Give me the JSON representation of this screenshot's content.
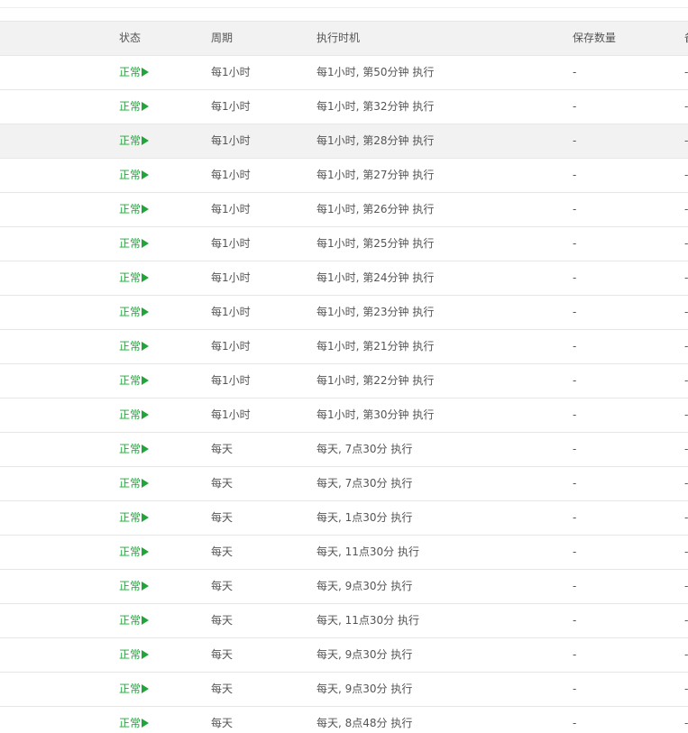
{
  "table": {
    "headers": {
      "status": "状态",
      "cycle": "周期",
      "exec_time": "执行时机",
      "keep_count": "保存数量",
      "op_partial": "备"
    },
    "rows": [
      {
        "status": "正常",
        "cycle": "每1小时",
        "exec_time": "每1小时, 第50分钟 执行",
        "keep_count": "-",
        "op": "-"
      },
      {
        "status": "正常",
        "cycle": "每1小时",
        "exec_time": "每1小时, 第32分钟 执行",
        "keep_count": "-",
        "op": "-"
      },
      {
        "status": "正常",
        "cycle": "每1小时",
        "exec_time": "每1小时, 第28分钟 执行",
        "keep_count": "-",
        "op": "-"
      },
      {
        "status": "正常",
        "cycle": "每1小时",
        "exec_time": "每1小时, 第27分钟 执行",
        "keep_count": "-",
        "op": "-"
      },
      {
        "status": "正常",
        "cycle": "每1小时",
        "exec_time": "每1小时, 第26分钟 执行",
        "keep_count": "-",
        "op": "-"
      },
      {
        "status": "正常",
        "cycle": "每1小时",
        "exec_time": "每1小时, 第25分钟 执行",
        "keep_count": "-",
        "op": "-"
      },
      {
        "status": "正常",
        "cycle": "每1小时",
        "exec_time": "每1小时, 第24分钟 执行",
        "keep_count": "-",
        "op": "-"
      },
      {
        "status": "正常",
        "cycle": "每1小时",
        "exec_time": "每1小时, 第23分钟 执行",
        "keep_count": "-",
        "op": "-"
      },
      {
        "status": "正常",
        "cycle": "每1小时",
        "exec_time": "每1小时, 第21分钟 执行",
        "keep_count": "-",
        "op": "-"
      },
      {
        "status": "正常",
        "cycle": "每1小时",
        "exec_time": "每1小时, 第22分钟 执行",
        "keep_count": "-",
        "op": "-"
      },
      {
        "status": "正常",
        "cycle": "每1小时",
        "exec_time": "每1小时, 第30分钟 执行",
        "keep_count": "-",
        "op": "-"
      },
      {
        "status": "正常",
        "cycle": "每天",
        "exec_time": "每天, 7点30分 执行",
        "keep_count": "-",
        "op": "-"
      },
      {
        "status": "正常",
        "cycle": "每天",
        "exec_time": "每天, 7点30分 执行",
        "keep_count": "-",
        "op": "-"
      },
      {
        "status": "正常",
        "cycle": "每天",
        "exec_time": "每天, 1点30分 执行",
        "keep_count": "-",
        "op": "-"
      },
      {
        "status": "正常",
        "cycle": "每天",
        "exec_time": "每天, 11点30分 执行",
        "keep_count": "-",
        "op": "-"
      },
      {
        "status": "正常",
        "cycle": "每天",
        "exec_time": "每天, 9点30分 执行",
        "keep_count": "-",
        "op": "-"
      },
      {
        "status": "正常",
        "cycle": "每天",
        "exec_time": "每天, 11点30分 执行",
        "keep_count": "-",
        "op": "-"
      },
      {
        "status": "正常",
        "cycle": "每天",
        "exec_time": "每天, 9点30分 执行",
        "keep_count": "-",
        "op": "-"
      },
      {
        "status": "正常",
        "cycle": "每天",
        "exec_time": "每天, 9点30分 执行",
        "keep_count": "-",
        "op": "-"
      },
      {
        "status": "正常",
        "cycle": "每天",
        "exec_time": "每天, 8点48分 执行",
        "keep_count": "-",
        "op": "-"
      }
    ]
  },
  "colors": {
    "status_ok": "#20a53a",
    "header_bg": "#f2f2f2",
    "row_hover_bg": "#f2f2f2",
    "border": "#e6e6e6"
  },
  "icons": {
    "status_action": "play-icon"
  }
}
